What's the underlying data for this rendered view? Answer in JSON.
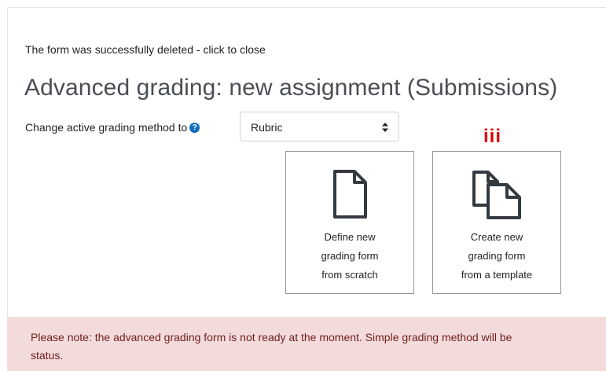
{
  "notice": {
    "text": "The form was successfully deleted - click to close"
  },
  "heading": {
    "title": "Advanced grading: new assignment (Submissions)"
  },
  "grading_method": {
    "label": "Change active grading method to",
    "help_symbol": "?",
    "selected": "Rubric"
  },
  "annotation": {
    "marker": "iii",
    "color": "#e30000"
  },
  "cards": {
    "scratch": {
      "line1": "Define new",
      "line2": "grading form",
      "line3": "from scratch",
      "icon": "document-icon"
    },
    "template": {
      "line1": "Create new",
      "line2": "grading form",
      "line3": "from a template",
      "icon": "documents-copy-icon"
    }
  },
  "alert": {
    "line1": "Please note: the advanced grading form is not ready at the moment. Simple grading method will be",
    "line2": "status."
  },
  "colors": {
    "accent": "#0f6cbf",
    "alert_bg": "#f4dbdb",
    "alert_text": "#6e1d1d"
  }
}
